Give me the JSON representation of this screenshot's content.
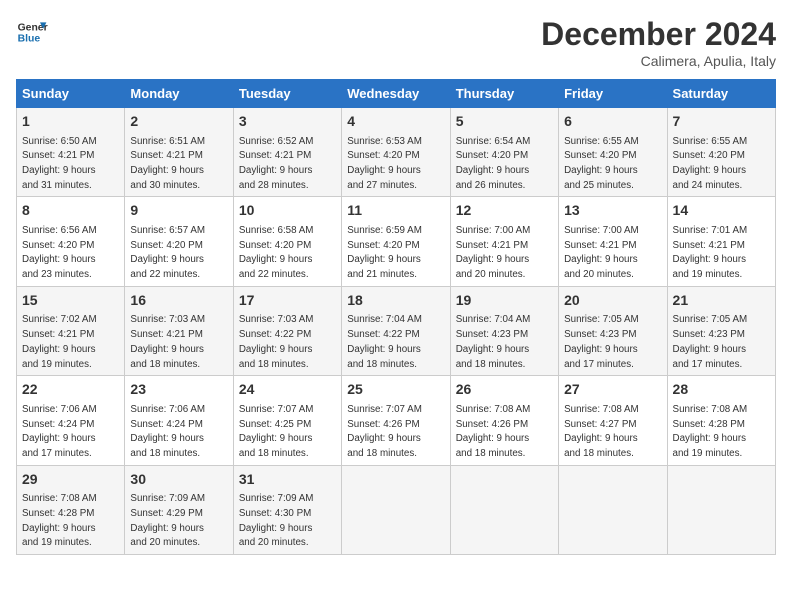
{
  "header": {
    "logo_line1": "General",
    "logo_line2": "Blue",
    "month": "December 2024",
    "location": "Calimera, Apulia, Italy"
  },
  "weekdays": [
    "Sunday",
    "Monday",
    "Tuesday",
    "Wednesday",
    "Thursday",
    "Friday",
    "Saturday"
  ],
  "weeks": [
    [
      {
        "day": "1",
        "sunrise": "6:50 AM",
        "sunset": "4:21 PM",
        "daylight": "9 hours and 31 minutes."
      },
      {
        "day": "2",
        "sunrise": "6:51 AM",
        "sunset": "4:21 PM",
        "daylight": "9 hours and 30 minutes."
      },
      {
        "day": "3",
        "sunrise": "6:52 AM",
        "sunset": "4:21 PM",
        "daylight": "9 hours and 28 minutes."
      },
      {
        "day": "4",
        "sunrise": "6:53 AM",
        "sunset": "4:20 PM",
        "daylight": "9 hours and 27 minutes."
      },
      {
        "day": "5",
        "sunrise": "6:54 AM",
        "sunset": "4:20 PM",
        "daylight": "9 hours and 26 minutes."
      },
      {
        "day": "6",
        "sunrise": "6:55 AM",
        "sunset": "4:20 PM",
        "daylight": "9 hours and 25 minutes."
      },
      {
        "day": "7",
        "sunrise": "6:55 AM",
        "sunset": "4:20 PM",
        "daylight": "9 hours and 24 minutes."
      }
    ],
    [
      {
        "day": "8",
        "sunrise": "6:56 AM",
        "sunset": "4:20 PM",
        "daylight": "9 hours and 23 minutes."
      },
      {
        "day": "9",
        "sunrise": "6:57 AM",
        "sunset": "4:20 PM",
        "daylight": "9 hours and 22 minutes."
      },
      {
        "day": "10",
        "sunrise": "6:58 AM",
        "sunset": "4:20 PM",
        "daylight": "9 hours and 22 minutes."
      },
      {
        "day": "11",
        "sunrise": "6:59 AM",
        "sunset": "4:20 PM",
        "daylight": "9 hours and 21 minutes."
      },
      {
        "day": "12",
        "sunrise": "7:00 AM",
        "sunset": "4:21 PM",
        "daylight": "9 hours and 20 minutes."
      },
      {
        "day": "13",
        "sunrise": "7:00 AM",
        "sunset": "4:21 PM",
        "daylight": "9 hours and 20 minutes."
      },
      {
        "day": "14",
        "sunrise": "7:01 AM",
        "sunset": "4:21 PM",
        "daylight": "9 hours and 19 minutes."
      }
    ],
    [
      {
        "day": "15",
        "sunrise": "7:02 AM",
        "sunset": "4:21 PM",
        "daylight": "9 hours and 19 minutes."
      },
      {
        "day": "16",
        "sunrise": "7:03 AM",
        "sunset": "4:21 PM",
        "daylight": "9 hours and 18 minutes."
      },
      {
        "day": "17",
        "sunrise": "7:03 AM",
        "sunset": "4:22 PM",
        "daylight": "9 hours and 18 minutes."
      },
      {
        "day": "18",
        "sunrise": "7:04 AM",
        "sunset": "4:22 PM",
        "daylight": "9 hours and 18 minutes."
      },
      {
        "day": "19",
        "sunrise": "7:04 AM",
        "sunset": "4:23 PM",
        "daylight": "9 hours and 18 minutes."
      },
      {
        "day": "20",
        "sunrise": "7:05 AM",
        "sunset": "4:23 PM",
        "daylight": "9 hours and 17 minutes."
      },
      {
        "day": "21",
        "sunrise": "7:05 AM",
        "sunset": "4:23 PM",
        "daylight": "9 hours and 17 minutes."
      }
    ],
    [
      {
        "day": "22",
        "sunrise": "7:06 AM",
        "sunset": "4:24 PM",
        "daylight": "9 hours and 17 minutes."
      },
      {
        "day": "23",
        "sunrise": "7:06 AM",
        "sunset": "4:24 PM",
        "daylight": "9 hours and 18 minutes."
      },
      {
        "day": "24",
        "sunrise": "7:07 AM",
        "sunset": "4:25 PM",
        "daylight": "9 hours and 18 minutes."
      },
      {
        "day": "25",
        "sunrise": "7:07 AM",
        "sunset": "4:26 PM",
        "daylight": "9 hours and 18 minutes."
      },
      {
        "day": "26",
        "sunrise": "7:08 AM",
        "sunset": "4:26 PM",
        "daylight": "9 hours and 18 minutes."
      },
      {
        "day": "27",
        "sunrise": "7:08 AM",
        "sunset": "4:27 PM",
        "daylight": "9 hours and 18 minutes."
      },
      {
        "day": "28",
        "sunrise": "7:08 AM",
        "sunset": "4:28 PM",
        "daylight": "9 hours and 19 minutes."
      }
    ],
    [
      {
        "day": "29",
        "sunrise": "7:08 AM",
        "sunset": "4:28 PM",
        "daylight": "9 hours and 19 minutes."
      },
      {
        "day": "30",
        "sunrise": "7:09 AM",
        "sunset": "4:29 PM",
        "daylight": "9 hours and 20 minutes."
      },
      {
        "day": "31",
        "sunrise": "7:09 AM",
        "sunset": "4:30 PM",
        "daylight": "9 hours and 20 minutes."
      },
      null,
      null,
      null,
      null
    ]
  ]
}
